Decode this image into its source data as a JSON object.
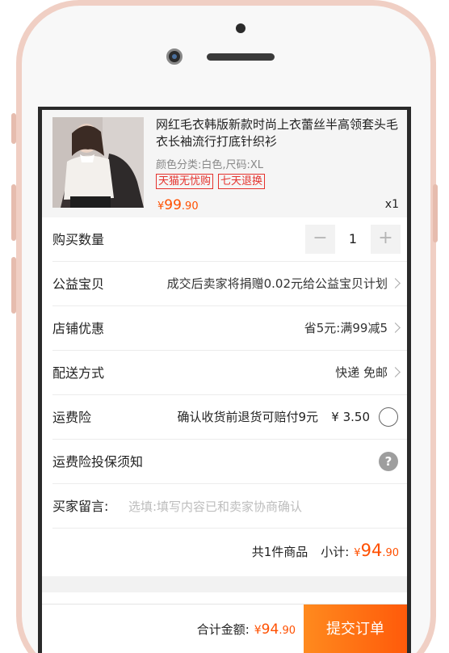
{
  "product": {
    "title": "网红毛衣韩版新款时尚上衣蕾丝半高领套头毛衣长袖流行打底针织衫",
    "sku": "颜色分类:白色,尺码:XL",
    "tags": [
      "天猫无忧购",
      "七天退换"
    ],
    "price": {
      "currency": "¥",
      "integer": "99",
      "decimal": ".90"
    },
    "quantity_label": "x1"
  },
  "rows": {
    "quantity": {
      "label": "购买数量",
      "value": "1",
      "minus": "−",
      "plus": "+"
    },
    "charity": {
      "label": "公益宝贝",
      "value": "成交后卖家将捐赠0.02元给公益宝贝计划"
    },
    "coupon": {
      "label": "店铺优惠",
      "value": "省5元:满99减5"
    },
    "delivery": {
      "label": "配送方式",
      "value": "快递 免邮"
    },
    "insurance": {
      "label": "运费险",
      "text": "确认收货前退货可赔付9元",
      "price": "¥ 3.50"
    },
    "insurance_notice": {
      "label": "运费险投保须知",
      "help": "?"
    },
    "message": {
      "label": "买家留言:",
      "placeholder": "选填:填写内容已和卖家协商确认"
    }
  },
  "subtotal": {
    "count": "共1件商品",
    "label": "小计:",
    "currency": "¥",
    "integer": "94",
    "decimal": ".90"
  },
  "footer": {
    "total_label": "合计金额:",
    "currency": "¥",
    "integer": "94",
    "decimal": ".90",
    "submit_label": "提交订单"
  },
  "colors": {
    "accent": "#ff5000",
    "tag": "#e5322d",
    "submit_start": "#ff8a1e",
    "submit_end": "#ff5a0a",
    "phone_frame": "#f0cfc4"
  }
}
